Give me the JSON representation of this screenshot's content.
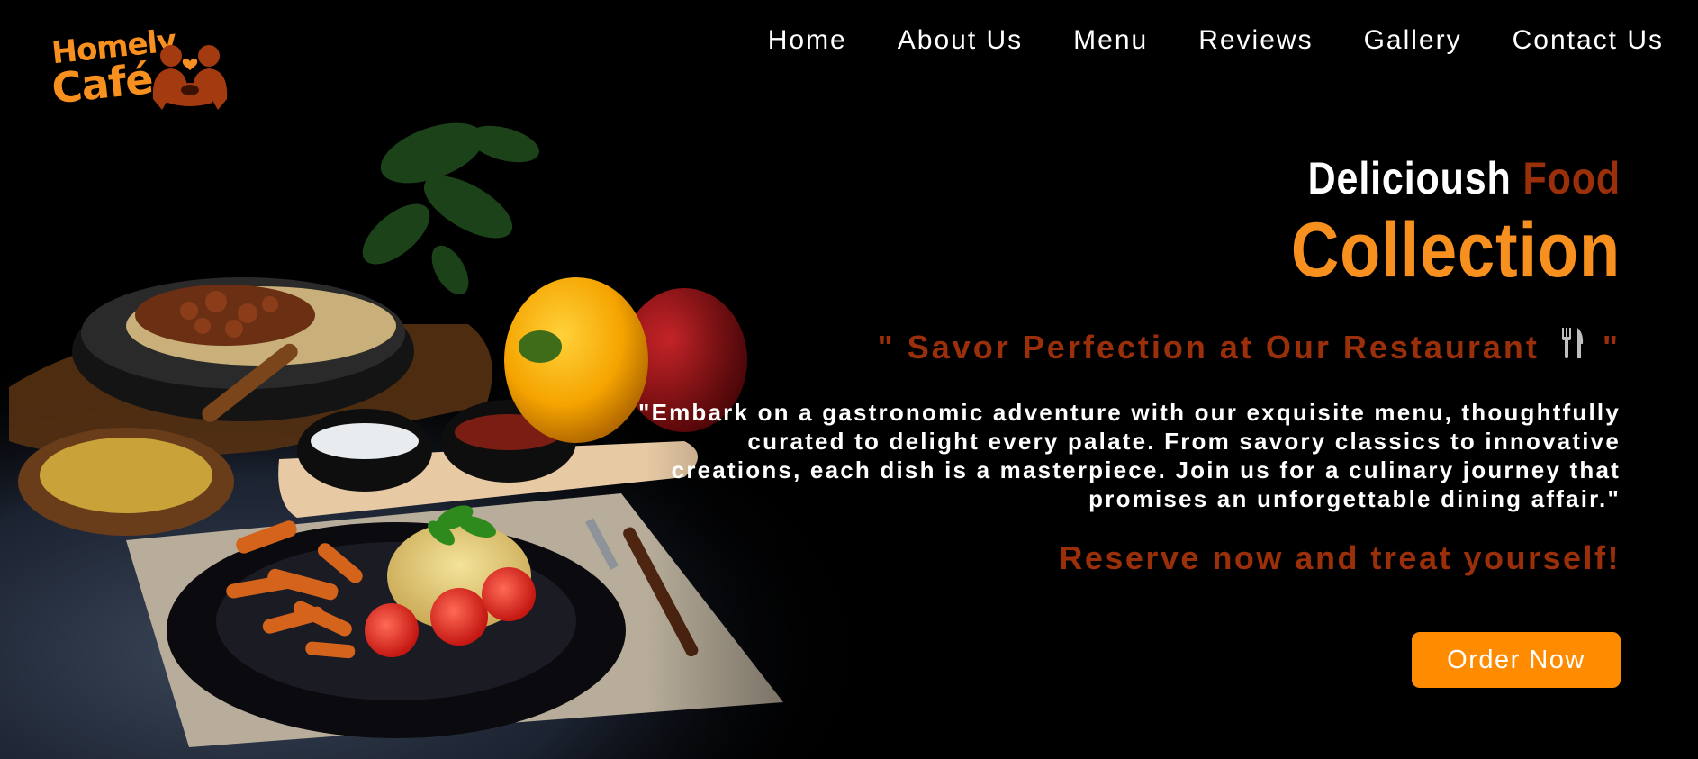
{
  "brand": {
    "logo_line1": "Homely",
    "logo_line2": "Café"
  },
  "nav": {
    "items": [
      {
        "label": "Home"
      },
      {
        "label": "About Us"
      },
      {
        "label": "Menu"
      },
      {
        "label": "Reviews"
      },
      {
        "label": "Gallery"
      },
      {
        "label": "Contact Us"
      }
    ]
  },
  "hero": {
    "headline_white": "Delicioush",
    "headline_accent": "Food",
    "headline_big": "Collection",
    "tagline_start": "\" Savor Perfection at Our Restaurant",
    "tagline_icon": "fork-and-knife-icon",
    "tagline_end": "\"",
    "description": "\"Embark on a gastronomic adventure with our exquisite menu, thoughtfully curated to delight every palate. From savory classics to innovative creations, each dish is a masterpiece. Join us for a culinary journey that promises an unforgettable dining affair.\"",
    "cta_text": "Reserve now and treat yourself!",
    "order_button": "Order Now"
  },
  "colors": {
    "accent_orange": "#f7901e",
    "button_orange": "#ff8c00",
    "rust": "#9b2f0a",
    "background": "#000000",
    "text": "#ffffff"
  }
}
